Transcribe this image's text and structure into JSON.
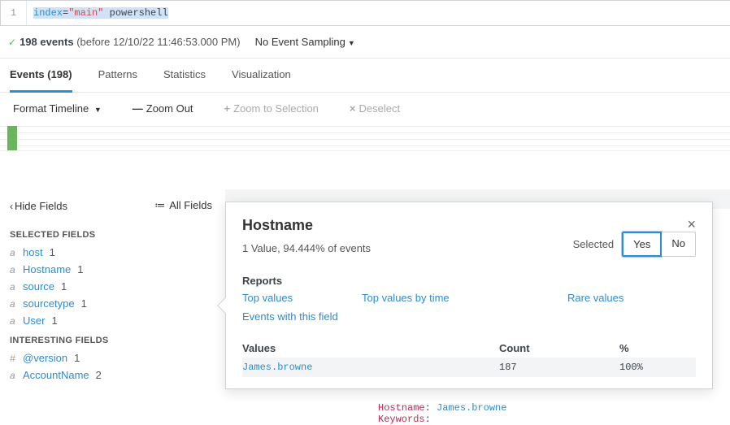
{
  "search": {
    "line": "1",
    "kw_index": "index",
    "eq": "=",
    "str": "\"main\"",
    "term": " powershell"
  },
  "status": {
    "events": "198 events",
    "timestamp": "(before 12/10/22 11:46:53.000 PM)",
    "sampling": "No Event Sampling"
  },
  "tabs": {
    "events": "Events (198)",
    "patterns": "Patterns",
    "statistics": "Statistics",
    "visualization": "Visualization"
  },
  "toolbar": {
    "format": "Format Timeline",
    "zoom_out": "Zoom Out",
    "zoom_sel": "Zoom to Selection",
    "deselect": "Deselect"
  },
  "sidebar": {
    "hide": "Hide Fields",
    "all": "All Fields",
    "selected_head": "SELECTED FIELDS",
    "interesting_head": "INTERESTING FIELDS",
    "selected": [
      {
        "type": "a",
        "name": "host",
        "count": "1"
      },
      {
        "type": "a",
        "name": "Hostname",
        "count": "1"
      },
      {
        "type": "a",
        "name": "source",
        "count": "1"
      },
      {
        "type": "a",
        "name": "sourcetype",
        "count": "1"
      },
      {
        "type": "a",
        "name": "User",
        "count": "1"
      }
    ],
    "interesting": [
      {
        "type": "#",
        "name": "@version",
        "count": "1"
      },
      {
        "type": "a",
        "name": "AccountName",
        "count": "2"
      }
    ]
  },
  "popup": {
    "title": "Hostname",
    "subtitle": "1 Value, 94.444% of events",
    "selected_label": "Selected",
    "yes": "Yes",
    "no": "No",
    "reports_head": "Reports",
    "reports": {
      "top": "Top values",
      "top_time": "Top values by time",
      "rare": "Rare values",
      "events_with": "Events with this field"
    },
    "values_head": {
      "v": "Values",
      "c": "Count",
      "p": "%"
    },
    "rows": [
      {
        "v": "James.browne",
        "c": "187",
        "p": "100%"
      }
    ]
  },
  "event_snippet": {
    "k1": "Hostname",
    "v1": "James.browne",
    "k2": "Keywords"
  }
}
